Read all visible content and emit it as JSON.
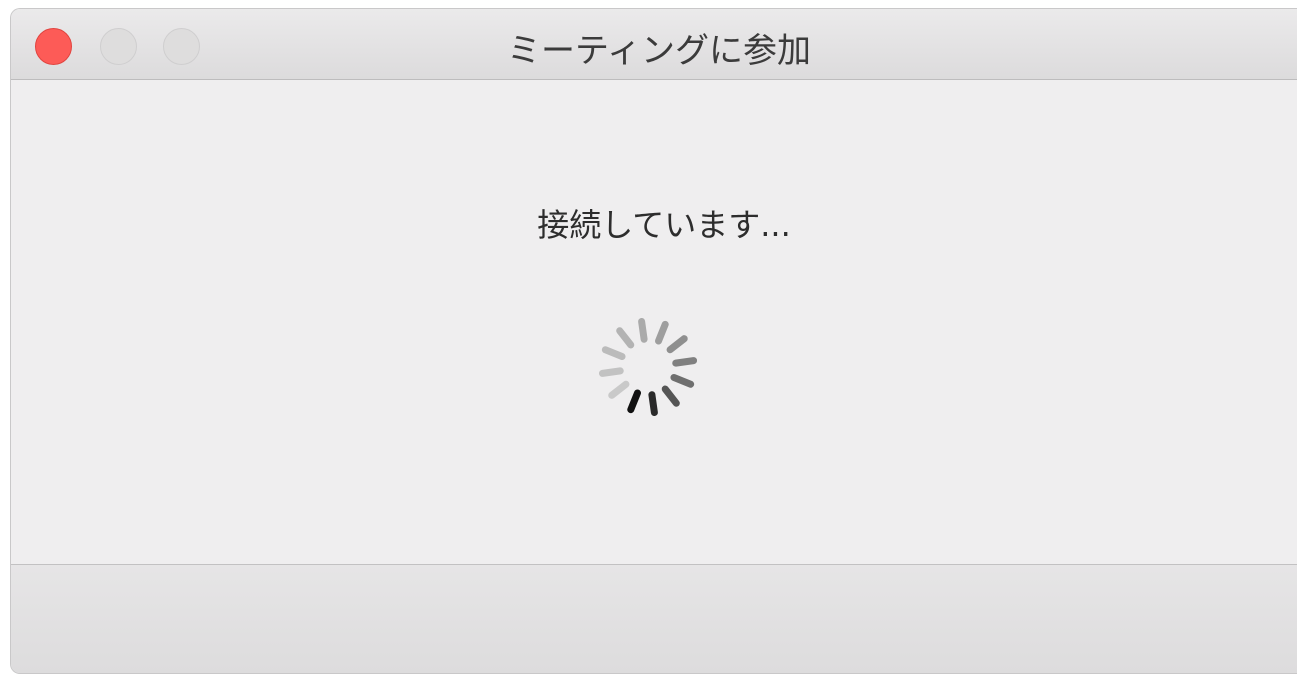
{
  "window": {
    "title": "ミーティングに参加"
  },
  "traffic_lights": {
    "close": {
      "icon": "close-dot",
      "color": "#fd5b57"
    },
    "minimize": {
      "icon": "minimize-dot",
      "color": "#dedddd"
    },
    "zoom": {
      "icon": "zoom-dot",
      "color": "#dedddd"
    }
  },
  "main": {
    "status_text": "接続しています...",
    "spinner_icon": "loading-spinner-icon"
  }
}
